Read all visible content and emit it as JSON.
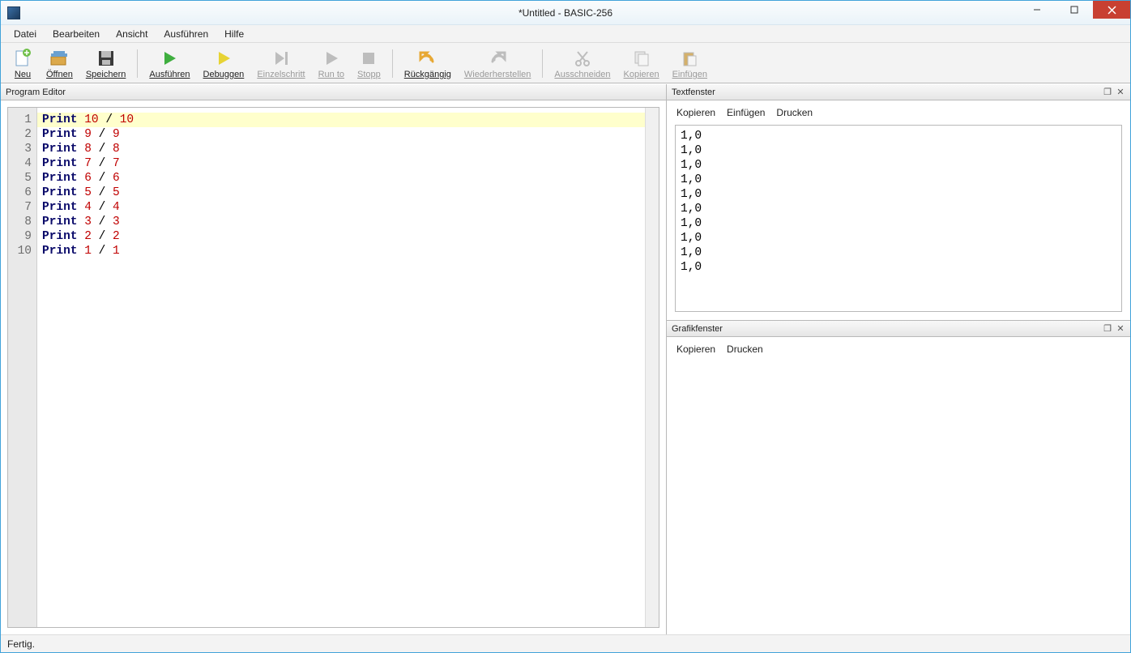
{
  "window": {
    "title": "*Untitled - BASIC-256"
  },
  "menus": {
    "file": "Datei",
    "edit": "Bearbeiten",
    "view": "Ansicht",
    "run": "Ausführen",
    "help": "Hilfe"
  },
  "toolbar": {
    "new": "Neu",
    "open": "Öffnen",
    "save": "Speichern",
    "run": "Ausführen",
    "debug": "Debuggen",
    "step": "Einzelschritt",
    "runto": "Run to",
    "stop": "Stopp",
    "undo": "Rückgängig",
    "redo": "Wiederherstellen",
    "cut": "Ausschneiden",
    "copy": "Kopieren",
    "paste": "Einfügen"
  },
  "panes": {
    "editor_title": "Program Editor",
    "text_title": "Textfenster",
    "grafik_title": "Grafikfenster"
  },
  "text_toolbar": {
    "copy": "Kopieren",
    "paste": "Einfügen",
    "print": "Drucken"
  },
  "grafik_toolbar": {
    "copy": "Kopieren",
    "print": "Drucken"
  },
  "code_lines": [
    {
      "n": "1",
      "kw": "Print",
      "a": "10",
      "b": "10"
    },
    {
      "n": "2",
      "kw": "Print",
      "a": "9",
      "b": "9"
    },
    {
      "n": "3",
      "kw": "Print",
      "a": "8",
      "b": "8"
    },
    {
      "n": "4",
      "kw": "Print",
      "a": "7",
      "b": "7"
    },
    {
      "n": "5",
      "kw": "Print",
      "a": "6",
      "b": "6"
    },
    {
      "n": "6",
      "kw": "Print",
      "a": "5",
      "b": "5"
    },
    {
      "n": "7",
      "kw": "Print",
      "a": "4",
      "b": "4"
    },
    {
      "n": "8",
      "kw": "Print",
      "a": "3",
      "b": "3"
    },
    {
      "n": "9",
      "kw": "Print",
      "a": "2",
      "b": "2"
    },
    {
      "n": "10",
      "kw": "Print",
      "a": "1",
      "b": "1"
    }
  ],
  "output_lines": [
    "1,0",
    "1,0",
    "1,0",
    "1,0",
    "1,0",
    "1,0",
    "1,0",
    "1,0",
    "1,0",
    "1,0"
  ],
  "status": "Fertig."
}
